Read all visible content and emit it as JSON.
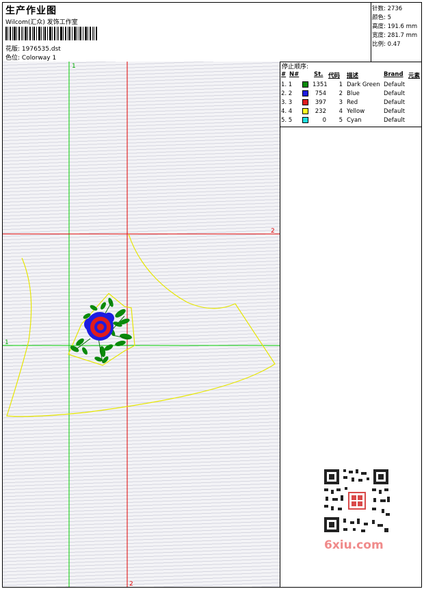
{
  "header": {
    "title": "生产作业图",
    "company": "Wilcom(汇众) 发饰工作室",
    "design_label": "花版:",
    "design_value": "1976535.dst",
    "colorway_label": "色位:",
    "colorway_value": "Colorway 1"
  },
  "stats": {
    "stitches_label": "针数:",
    "stitches_value": "2736",
    "colors_label": "颜色:",
    "colors_value": "5",
    "height_label": "高度:",
    "height_value": "191.6 mm",
    "width_label": "宽度:",
    "width_value": "281.7 mm",
    "scale_label": "比例:",
    "scale_value": "0.47"
  },
  "panel": {
    "title": "停止顺序:",
    "columns": {
      "hash": "#",
      "num": "N#",
      "st": "St.",
      "code": "代码",
      "desc": "描述",
      "brand": "Brand",
      "element": "元素"
    },
    "rows": [
      {
        "idx": "1. 1",
        "color": "#0a8a0a",
        "st": "1351",
        "code": "1",
        "desc": "Dark Green",
        "brand": "Default"
      },
      {
        "idx": "2. 2",
        "color": "#1c1ce0",
        "st": "754",
        "code": "2",
        "desc": "Blue",
        "brand": "Default"
      },
      {
        "idx": "3. 3",
        "color": "#e01c1c",
        "st": "397",
        "code": "3",
        "desc": "Red",
        "brand": "Default"
      },
      {
        "idx": "4. 4",
        "color": "#ffff20",
        "st": "232",
        "code": "4",
        "desc": "Yellow",
        "brand": "Default"
      },
      {
        "idx": "5. 5",
        "color": "#20e0e0",
        "st": "0",
        "code": "5",
        "desc": "Cyan",
        "brand": "Default"
      }
    ]
  },
  "guides": {
    "v1_label": "1",
    "v2_label": "2",
    "h1_label": "1",
    "h2_label": "2"
  },
  "colors": {
    "guide_green": "#00cc00",
    "guide_red": "#e00000",
    "outline_yellow": "#e6e600",
    "watermark": "#f08a8a",
    "qr_stamp": "#d94a4a"
  },
  "watermark": {
    "text": "6xiu.com"
  }
}
